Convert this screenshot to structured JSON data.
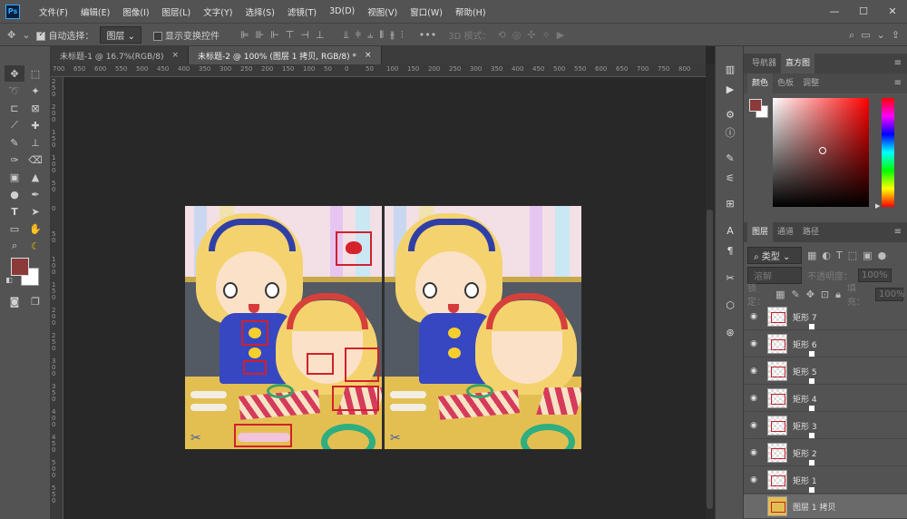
{
  "app": {
    "logo": "Ps"
  },
  "menu": [
    "文件(F)",
    "编辑(E)",
    "图像(I)",
    "图层(L)",
    "文字(Y)",
    "选择(S)",
    "滤镜(T)",
    "3D(D)",
    "视图(V)",
    "窗口(W)",
    "帮助(H)"
  ],
  "window_controls": {
    "minimize": "—",
    "maximize": "☐",
    "close": "✕"
  },
  "options": {
    "auto_select_label": "自动选择：",
    "auto_select_value": "图层",
    "show_transform_label": "显示变换控件",
    "mode_3d_label": "3D 模式："
  },
  "tabs": [
    {
      "label": "未标题-1 @ 16.7%(RGB/8)",
      "close": "×"
    },
    {
      "label": "未标题-2 @ 100% (图层 1 拷贝, RGB/8) *",
      "close": "×"
    }
  ],
  "ruler": {
    "top": [
      "700",
      "650",
      "600",
      "550",
      "500",
      "450",
      "400",
      "350",
      "300",
      "250",
      "200",
      "150",
      "100",
      "50",
      "0",
      "50",
      "100",
      "150",
      "200",
      "250",
      "300",
      "350",
      "400",
      "450",
      "500",
      "550",
      "600",
      "650",
      "700",
      "750",
      "800"
    ],
    "left": [
      "250",
      "200",
      "150",
      "100",
      "50",
      "0",
      "50",
      "100",
      "150",
      "200",
      "250",
      "300",
      "350",
      "400",
      "450",
      "500",
      "550"
    ]
  },
  "panels": {
    "top_tabs": [
      "导航器",
      "直方图"
    ],
    "color_tabs": [
      "颜色",
      "色板",
      "调整"
    ],
    "layers_tabs": [
      "图层",
      "通道",
      "路径"
    ],
    "filter_kind": "类型",
    "blend_mode": "溶解",
    "opacity_label": "不透明度：",
    "opacity_value": "100%",
    "lock_label": "锁定：",
    "fill_label": "填充：",
    "fill_value": "100%"
  },
  "colors": {
    "foreground": "#8b3a3a",
    "background": "#ffffff",
    "marker": "#d0212b",
    "picker_hue": "#ff0000"
  },
  "layers": [
    {
      "name": "矩形 7"
    },
    {
      "name": "矩形 6"
    },
    {
      "name": "矩形 5"
    },
    {
      "name": "矩形 4"
    },
    {
      "name": "矩形 3"
    },
    {
      "name": "矩形 2"
    },
    {
      "name": "矩形 1"
    },
    {
      "name": "图层 1 拷贝"
    }
  ]
}
